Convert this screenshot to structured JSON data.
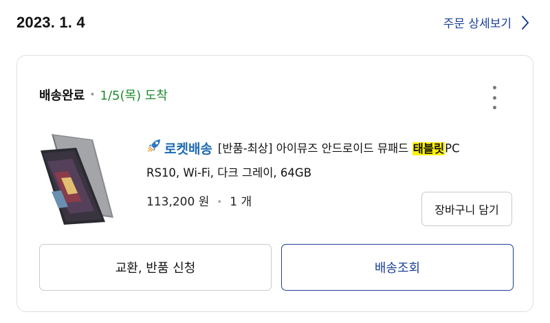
{
  "header": {
    "order_date": "2023. 1. 4",
    "detail_link": "주문 상세보기"
  },
  "order": {
    "status": "배송완료",
    "arrival": "1/5(목) 도착",
    "product": {
      "badge": "로켓배송",
      "title_prefix": "[반품-최상] 아이뮤즈 안드로이드 뮤패드 ",
      "title_highlight": "태블릿",
      "title_suffix": "PC",
      "title_line2": "RS10, Wi-Fi, 다크 그레이, 64GB",
      "price": "113,200 원",
      "quantity": "1 개"
    },
    "cart_button": "장바구니 담기",
    "exchange_button": "교환, 반품 신청",
    "tracking_button": "배송조회"
  },
  "icons": {
    "detail_chevron": "chevron-right-icon",
    "more": "more-vertical-icon",
    "rocket": "rocket-icon"
  },
  "colors": {
    "link_blue": "#1a3f96",
    "arrival_green": "#1f8a2e",
    "rocket_blue": "#1d6ab3",
    "highlight_yellow": "#fff200"
  }
}
